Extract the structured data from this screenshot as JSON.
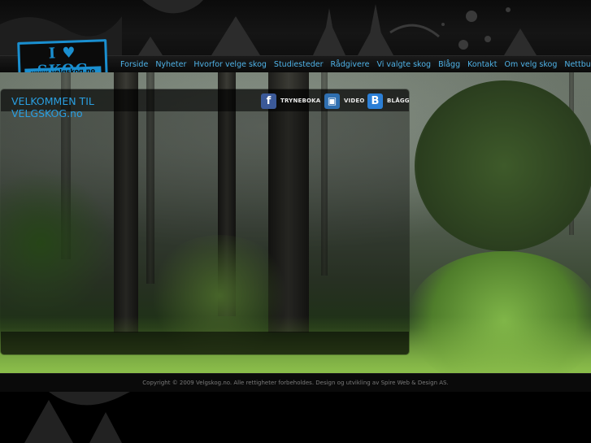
{
  "logo": {
    "brand_prefix": "I",
    "brand_word": "SKOG",
    "url": "www.velgskog.no"
  },
  "nav": {
    "items": [
      {
        "label": "Forside"
      },
      {
        "label": "Nyheter"
      },
      {
        "label": "Hvorfor velge skog"
      },
      {
        "label": "Studiesteder"
      },
      {
        "label": "Rådgivere"
      },
      {
        "label": "Vi valgte skog"
      },
      {
        "label": "Blågg"
      },
      {
        "label": "Kontakt"
      },
      {
        "label": "Om velg skog"
      },
      {
        "label": "Nettbutikk"
      }
    ]
  },
  "panel": {
    "title": "VELKOMMEN TIL VELGSKOG.no",
    "social": {
      "facebook": {
        "label": "TRYNEBOKA",
        "icon": "f"
      },
      "video": {
        "label": "VIDEO",
        "icon": "▣"
      },
      "blog": {
        "label": "BLÅGG",
        "icon": "B"
      }
    }
  },
  "footer": {
    "copyright": "Copyright © 2009 Velgskog.no. Alle rettigheter forbeholdes. Design og utvikling av Spire Web & Design AS."
  },
  "colors": {
    "accent": "#2a9ee0",
    "nav_text": "#4fb3e8",
    "facebook": "#3b5998",
    "video": "#2f6fb0",
    "blog": "#2c7fd6"
  }
}
